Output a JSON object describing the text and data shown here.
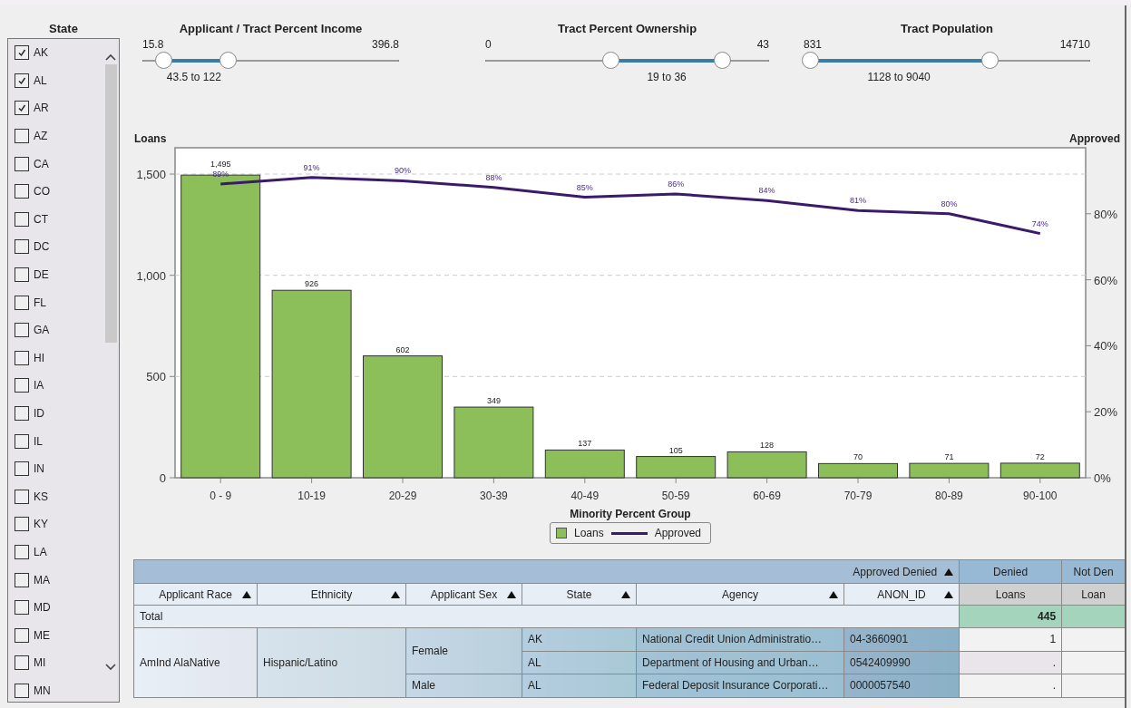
{
  "state_filter": {
    "title": "State",
    "items": [
      {
        "label": "AK",
        "checked": true
      },
      {
        "label": "AL",
        "checked": true
      },
      {
        "label": "AR",
        "checked": true
      },
      {
        "label": "AZ",
        "checked": false
      },
      {
        "label": "CA",
        "checked": false
      },
      {
        "label": "CO",
        "checked": false
      },
      {
        "label": "CT",
        "checked": false
      },
      {
        "label": "DC",
        "checked": false
      },
      {
        "label": "DE",
        "checked": false
      },
      {
        "label": "FL",
        "checked": false
      },
      {
        "label": "GA",
        "checked": false
      },
      {
        "label": "HI",
        "checked": false
      },
      {
        "label": "IA",
        "checked": false
      },
      {
        "label": "ID",
        "checked": false
      },
      {
        "label": "IL",
        "checked": false
      },
      {
        "label": "IN",
        "checked": false
      },
      {
        "label": "KS",
        "checked": false
      },
      {
        "label": "KY",
        "checked": false
      },
      {
        "label": "LA",
        "checked": false
      },
      {
        "label": "MA",
        "checked": false
      },
      {
        "label": "MD",
        "checked": false
      },
      {
        "label": "ME",
        "checked": false
      },
      {
        "label": "MI",
        "checked": false
      },
      {
        "label": "MN",
        "checked": false
      }
    ]
  },
  "sliders": [
    {
      "title": "Applicant / Tract Percent Income",
      "min": "15.8",
      "max": "396.8",
      "range_text": "43.5 to 122",
      "thumbs": [
        {
          "level": 0.08
        },
        {
          "level": 0.33
        }
      ]
    },
    {
      "title": "Tract Percent Ownership",
      "min": "0",
      "max": "43",
      "range_text": "19 to 36",
      "thumbs": [
        {
          "level": 0.44
        },
        {
          "level": 0.835
        }
      ]
    },
    {
      "title": "Tract Population",
      "min": "831",
      "max": "14710",
      "range_text": "1128 to 9040",
      "thumbs": [
        {
          "level": 0.02
        },
        {
          "level": 0.65
        }
      ]
    }
  ],
  "chart": {
    "bars": {
      "chart_data": {
        "type": "bar",
        "xlabel": "Minority Percent Group",
        "ylabel": "Loans",
        "categories": [
          "0 - 9",
          "10-19",
          "20-29",
          "30-39",
          "40-49",
          "50-59",
          "60-69",
          "70-79",
          "80-89",
          "90-100"
        ],
        "series": [
          {
            "name": "Loans",
            "color": "#8cbf5a",
            "values": [
              1495,
              926,
              602,
              349,
              137,
              105,
              128,
              70,
              71,
              72
            ],
            "value_labels": [
              "1,495",
              "926",
              "602",
              "349",
              "137",
              "105",
              "128",
              "70",
              "71",
              "72"
            ]
          }
        ],
        "ylim": [
          0,
          1630
        ],
        "yticks": [
          {
            "value": 0,
            "label": "0"
          },
          {
            "value": 500,
            "label": "500"
          },
          {
            "value": 1000,
            "label": "1,000"
          },
          {
            "value": 1500,
            "label": "1,500"
          }
        ],
        "grid": true,
        "data_labels": true
      }
    },
    "line": {
      "chart_data": {
        "type": "line",
        "ylabel": "Approved",
        "series": [
          {
            "name": "Approved",
            "color": "#3b1a6b",
            "values": [
              89,
              91,
              90,
              88,
              85,
              86,
              84,
              81,
              80,
              74
            ],
            "value_labels": [
              "89%",
              "91%",
              "90%",
              "88%",
              "85%",
              "86%",
              "84%",
              "81%",
              "80%",
              "74%"
            ]
          }
        ],
        "ylim": [
          0,
          100
        ],
        "yticks": [
          {
            "value": 0,
            "label": "0%"
          },
          {
            "value": 20,
            "label": "20%"
          },
          {
            "value": 40,
            "label": "40%"
          },
          {
            "value": 60,
            "label": "60%"
          },
          {
            "value": 80,
            "label": "80%"
          }
        ],
        "data_labels": true
      }
    }
  },
  "table": {
    "group_header": "Approved Denied",
    "measure_groups": [
      "Denied",
      "Not Den"
    ],
    "columns": [
      {
        "label": "Applicant Race",
        "kind": "dimension",
        "sortable": true
      },
      {
        "label": "Ethnicity",
        "kind": "dimension",
        "sortable": true
      },
      {
        "label": "Applicant Sex",
        "kind": "dimension",
        "sortable": true
      },
      {
        "label": "State",
        "kind": "dimension",
        "sortable": true
      },
      {
        "label": "Agency",
        "kind": "dimension",
        "sortable": true
      },
      {
        "label": "ANON_ID",
        "kind": "dimension",
        "sortable": true
      },
      {
        "label": "Loans",
        "kind": "measure",
        "sortable": false
      },
      {
        "label": "Loan",
        "kind": "measure",
        "sortable": false
      }
    ],
    "total_row": {
      "label": "Total",
      "value": "445"
    },
    "rows": [
      {
        "label": "AmInd AlaNative",
        "children": [
          {
            "label": "Hispanic/Latino",
            "children": [
              {
                "label": "Female",
                "children": [
                  {
                    "state": "AK",
                    "agency": "National Credit Union Administratio…",
                    "anon_id": "04-3660901",
                    "loans": "1"
                  },
                  {
                    "state": "AL",
                    "agency": "Department of Housing and Urban…",
                    "anon_id": "0542409990",
                    "loans": "."
                  }
                ]
              },
              {
                "label": "Male",
                "children": [
                  {
                    "state": "AL",
                    "agency": "Federal Deposit Insurance Corporati…",
                    "anon_id": "0000057540",
                    "loans": "."
                  }
                ]
              }
            ]
          }
        ]
      }
    ]
  }
}
